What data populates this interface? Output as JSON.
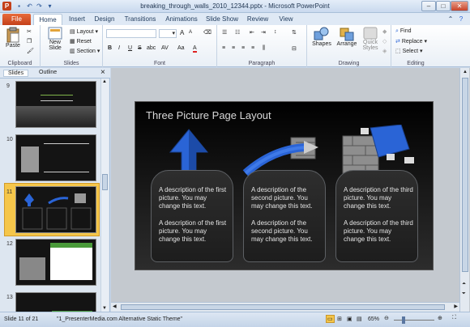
{
  "window": {
    "title": "breaking_through_walls_2010_12344.pptx - Microsoft PowerPoint"
  },
  "tabs": [
    "File",
    "Home",
    "Insert",
    "Design",
    "Transitions",
    "Animations",
    "Slide Show",
    "Review",
    "View"
  ],
  "ribbon": {
    "clipboard": {
      "paste": "Paste",
      "label": "Clipboard"
    },
    "slides": {
      "new_slide_1": "New",
      "new_slide_2": "Slide",
      "layout": "Layout",
      "reset": "Reset",
      "section": "Section",
      "label": "Slides"
    },
    "font": {
      "label": "Font",
      "bold": "B",
      "italic": "I",
      "underline": "U",
      "strike": "S",
      "shadow": "abc",
      "spacing": "AV",
      "case": "Aa",
      "color": "A",
      "grow": "A",
      "shrink": "A"
    },
    "paragraph": {
      "label": "Paragraph"
    },
    "drawing": {
      "shapes": "Shapes",
      "arrange": "Arrange",
      "quick_1": "Quick",
      "quick_2": "Styles",
      "label": "Drawing"
    },
    "editing": {
      "find": "Find",
      "replace": "Replace",
      "select": "Select",
      "label": "Editing"
    }
  },
  "pane": {
    "tabs": [
      "Slides",
      "Outline"
    ],
    "close": "×",
    "slide_numbers": [
      "9",
      "10",
      "11",
      "12",
      "13"
    ]
  },
  "slide": {
    "title": "Three Picture Page Layout",
    "columns": [
      {
        "d1": "A description of the first picture.  You may change this text.",
        "d2": "A description of the first picture.  You may change this text."
      },
      {
        "d1": "A description of the second picture.  You may change this text.",
        "d2": "A description of the second picture.  You may change this text."
      },
      {
        "d1": "A description of the third picture.  You may change this text.",
        "d2": "A description of the third picture.  You may change this text."
      }
    ]
  },
  "status": {
    "slide": "Slide 11 of 21",
    "theme": "\"1_PresenterMedia.com Alternative Static Theme\"",
    "zoom": "65%"
  },
  "colors": {
    "file_tab": "#d2542a",
    "selected_thumb": "#f5c64a",
    "arrow_blue": "#2a64d6"
  }
}
